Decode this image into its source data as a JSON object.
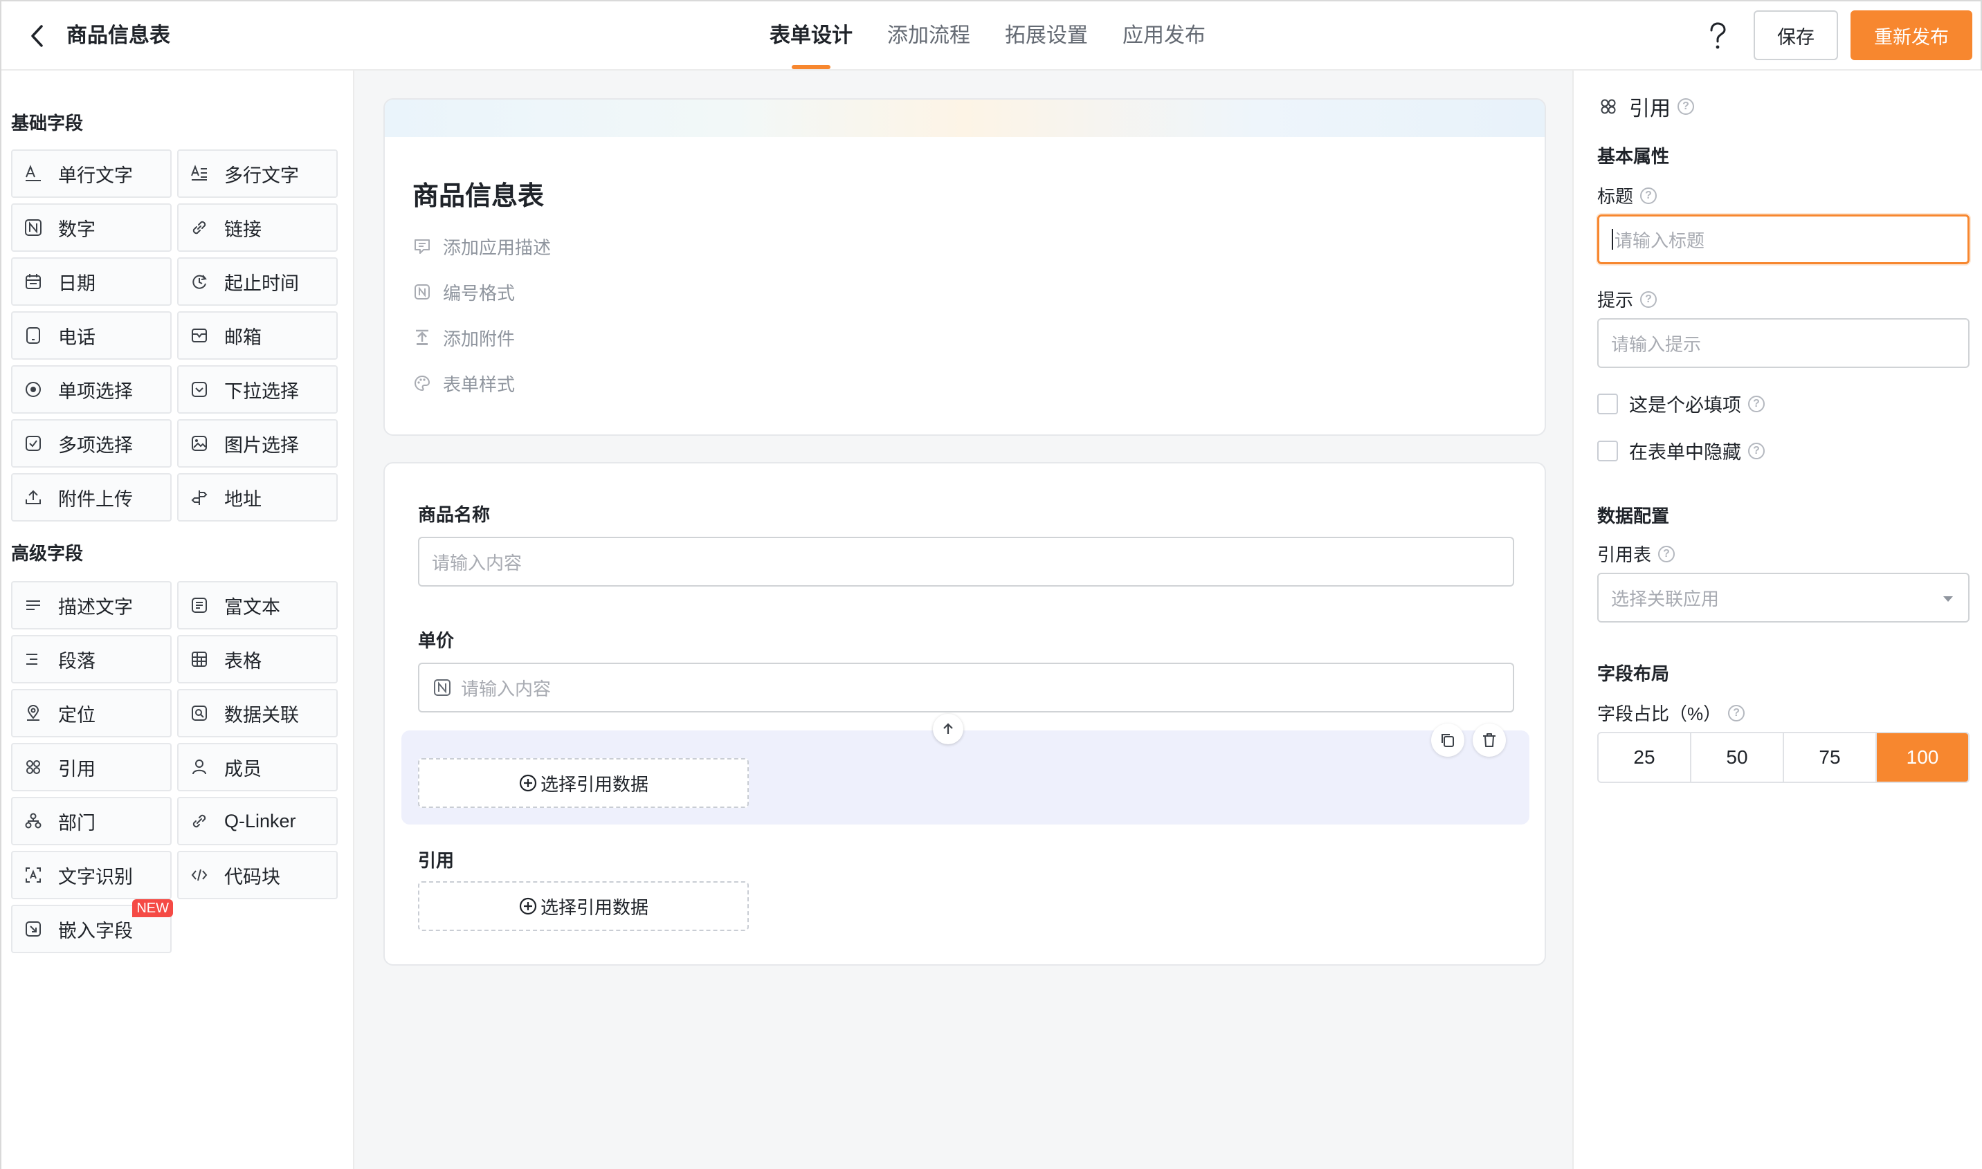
{
  "header": {
    "back_icon": "chevron-left-icon",
    "title": "商品信息表",
    "tabs": [
      {
        "label": "表单设计",
        "active": true
      },
      {
        "label": "添加流程",
        "active": false
      },
      {
        "label": "拓展设置",
        "active": false
      },
      {
        "label": "应用发布",
        "active": false
      }
    ],
    "help_label": "?",
    "save_label": "保存",
    "publish_label": "重新发布"
  },
  "colors": {
    "accent": "#f7872f",
    "highlight": "#eef0fc",
    "badge": "#f54a45"
  },
  "left_panel": {
    "basic_title": "基础字段",
    "basic_fields": [
      {
        "label": "单行文字",
        "icon": "single-line-text-icon"
      },
      {
        "label": "多行文字",
        "icon": "multi-line-text-icon"
      },
      {
        "label": "数字",
        "icon": "number-icon"
      },
      {
        "label": "链接",
        "icon": "link-icon"
      },
      {
        "label": "日期",
        "icon": "calendar-icon"
      },
      {
        "label": "起止时间",
        "icon": "time-range-icon"
      },
      {
        "label": "电话",
        "icon": "phone-icon"
      },
      {
        "label": "邮箱",
        "icon": "mail-icon"
      },
      {
        "label": "单项选择",
        "icon": "radio-icon"
      },
      {
        "label": "下拉选择",
        "icon": "dropdown-icon"
      },
      {
        "label": "多项选择",
        "icon": "checkbox-icon"
      },
      {
        "label": "图片选择",
        "icon": "image-icon"
      },
      {
        "label": "附件上传",
        "icon": "upload-icon"
      },
      {
        "label": "地址",
        "icon": "signpost-icon"
      }
    ],
    "advanced_title": "高级字段",
    "advanced_fields": [
      {
        "label": "描述文字",
        "icon": "description-icon"
      },
      {
        "label": "富文本",
        "icon": "rich-text-icon"
      },
      {
        "label": "段落",
        "icon": "paragraph-icon"
      },
      {
        "label": "表格",
        "icon": "table-icon"
      },
      {
        "label": "定位",
        "icon": "location-icon"
      },
      {
        "label": "数据关联",
        "icon": "data-link-icon"
      },
      {
        "label": "引用",
        "icon": "reference-icon"
      },
      {
        "label": "成员",
        "icon": "member-icon"
      },
      {
        "label": "部门",
        "icon": "department-icon"
      },
      {
        "label": "Q-Linker",
        "icon": "q-linker-icon"
      },
      {
        "label": "文字识别",
        "icon": "ocr-icon"
      },
      {
        "label": "代码块",
        "icon": "code-icon"
      },
      {
        "label": "嵌入字段",
        "icon": "embed-icon",
        "badge": "NEW"
      }
    ]
  },
  "canvas": {
    "form_title": "商品信息表",
    "meta": [
      {
        "label": "添加应用描述",
        "icon": "comment-icon"
      },
      {
        "label": "编号格式",
        "icon": "number-format-icon"
      },
      {
        "label": "添加附件",
        "icon": "upload-icon"
      },
      {
        "label": "表单样式",
        "icon": "palette-icon"
      }
    ],
    "fields": {
      "name_label": "商品名称",
      "name_placeholder": "请输入内容",
      "price_label": "单价",
      "price_placeholder": "请输入内容",
      "selected_ref_button": "选择引用数据",
      "ref_label": "引用",
      "ref_button": "选择引用数据"
    }
  },
  "right_panel": {
    "title": "引用",
    "basic_section": "基本属性",
    "title_label": "标题",
    "title_placeholder": "请输入标题",
    "hint_label": "提示",
    "hint_placeholder": "请输入提示",
    "required_label": "这是个必填项",
    "hidden_label": "在表单中隐藏",
    "data_section": "数据配置",
    "ref_table_label": "引用表",
    "ref_table_placeholder": "选择关联应用",
    "layout_section": "字段布局",
    "ratio_label": "字段占比（%）",
    "ratio_options": [
      "25",
      "50",
      "75",
      "100"
    ],
    "ratio_selected": "100"
  }
}
